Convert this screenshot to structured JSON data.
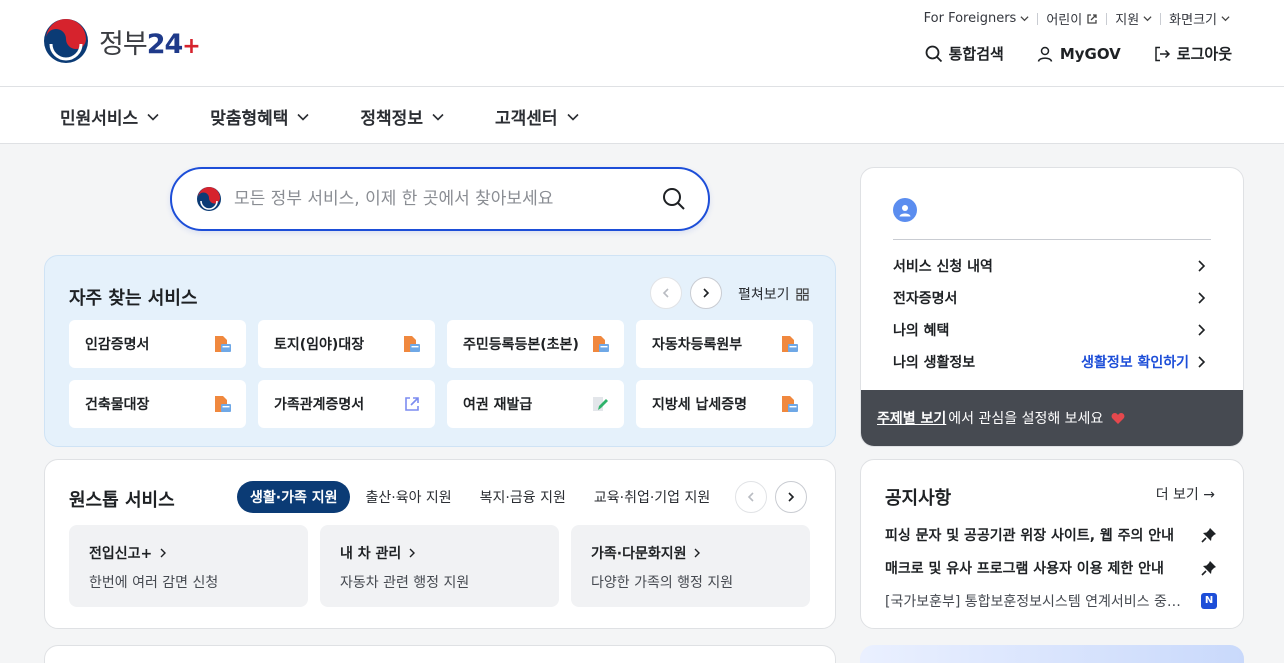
{
  "header": {
    "logo_text": "정부",
    "logo_num": "24",
    "logo_plus": "+",
    "util": [
      {
        "label": "For Foreigners",
        "icon": "chevron-down-icon"
      },
      {
        "label": "어린이",
        "icon": "external-link-icon"
      },
      {
        "label": "지원",
        "icon": "chevron-down-icon"
      },
      {
        "label": "화면크기",
        "icon": "chevron-down-icon"
      }
    ],
    "search_label": "통합검색",
    "mygov_label": "MyGOV",
    "logout_label": "로그아웃"
  },
  "gnb": [
    "민원서비스",
    "맞춤형혜택",
    "정책정보",
    "고객센터"
  ],
  "search": {
    "placeholder": "모든 정부 서비스, 이제 한 곳에서 찾아보세요"
  },
  "frequent": {
    "title": "자주 찾는 서비스",
    "expand_label": "펼쳐보기",
    "items": [
      {
        "label": "인감증명서",
        "icon": "document-print-icon"
      },
      {
        "label": "토지(임야)대장",
        "icon": "document-print-icon"
      },
      {
        "label": "주민등록등본(초본)",
        "icon": "document-print-icon"
      },
      {
        "label": "자동차등록원부",
        "icon": "document-print-icon"
      },
      {
        "label": "건축물대장",
        "icon": "document-print-icon"
      },
      {
        "label": "가족관계증명서",
        "icon": "external-link-icon"
      },
      {
        "label": "여권 재발급",
        "icon": "edit-pencil-icon"
      },
      {
        "label": "지방세 납세증명",
        "icon": "document-print-icon"
      }
    ]
  },
  "onestop": {
    "title": "원스톱 서비스",
    "tabs": [
      "생활·가족 지원",
      "출산·육아 지원",
      "복지·금융 지원",
      "교육·취업·기업 지원"
    ],
    "active_tab": 0,
    "cards": [
      {
        "title": "전입신고+",
        "desc": "한번에 여러 감면 신청"
      },
      {
        "title": "내 차 관리",
        "desc": "자동차 관련 행정 지원"
      },
      {
        "title": "가족·다문화지원",
        "desc": "다양한 가족의 행정 지원"
      }
    ]
  },
  "profile": {
    "rows": [
      {
        "label": "서비스 신청 내역",
        "right": ""
      },
      {
        "label": "전자증명서",
        "right": ""
      },
      {
        "label": "나의 혜택",
        "right": ""
      },
      {
        "label": "나의 생활정보",
        "right": "생활정보 확인하기"
      }
    ],
    "footer_link": "주제별 보기",
    "footer_text": "에서 관심을 설정해 보세요"
  },
  "notice": {
    "title": "공지사항",
    "more_label": "더 보기",
    "items": [
      {
        "text": "피싱 문자 및 공공기관 위장 사이트, 웹 주의 안내",
        "badge": ""
      },
      {
        "text": "매크로 및 유사 프로그램 사용자 이용 제한 안내",
        "badge": ""
      },
      {
        "text": "[국가보훈부] 통합보훈정보시스템 연계서비스 중…",
        "badge": "N"
      }
    ]
  },
  "colors": {
    "primary": "#1d4ed8",
    "navy": "#0b3b75",
    "heart": "#e5484d",
    "doc_icon": "#f0883e"
  }
}
